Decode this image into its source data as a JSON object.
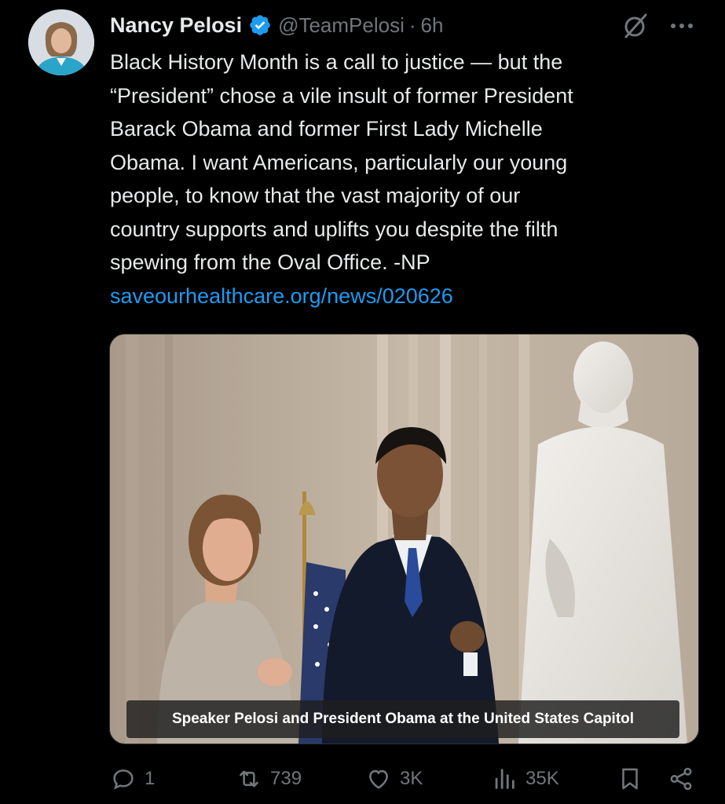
{
  "author": {
    "name": "Nancy Pelosi",
    "handle": "@TeamPelosi",
    "separator": "·",
    "time": "6h"
  },
  "tweet": {
    "lines": [
      "Black History Month is a call to justice — but the",
      "“President” chose a vile insult of former President",
      "Barack Obama and former First Lady Michelle",
      "Obama. I want Americans, particularly our young",
      "people, to know that the vast majority of our",
      "country supports and uplifts you despite the filth",
      "spewing from the Oval Office. -NP"
    ],
    "link": "saveourhealthcare.org/news/020626"
  },
  "media": {
    "caption": "Speaker Pelosi and President Obama at the United States Capitol"
  },
  "actions": {
    "replies": "1",
    "reposts": "739",
    "likes": "3K",
    "views": "35K"
  },
  "colors": {
    "background": "#000000",
    "text": "#e7e9ea",
    "muted": "#71767b",
    "link": "#1d9bf0",
    "verified": "#1d9bf0"
  },
  "icons": [
    "verified-badge-icon",
    "grok-icon",
    "more-icon",
    "reply-icon",
    "repost-icon",
    "like-icon",
    "views-icon",
    "bookmark-icon",
    "share-icon"
  ]
}
